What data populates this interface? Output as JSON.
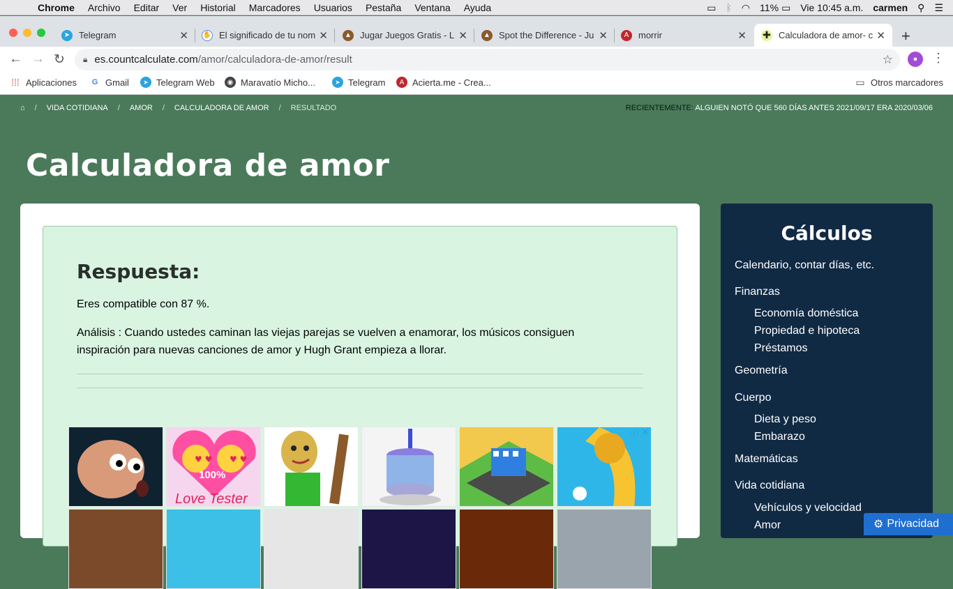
{
  "menubar": {
    "items": [
      "Chrome",
      "Archivo",
      "Editar",
      "Ver",
      "Historial",
      "Marcadores",
      "Usuarios",
      "Pestaña",
      "Ventana",
      "Ayuda"
    ],
    "battery": "11%",
    "clock": "Vie 10:45 a.m.",
    "user": "carmen"
  },
  "tabs": [
    {
      "label": "Telegram",
      "icon": "telegram-icon",
      "color": "#2aa3e0"
    },
    {
      "label": "El significado de tu nom",
      "icon": "hands-icon",
      "color": "#5b8bd6"
    },
    {
      "label": "Jugar Juegos Gratis - L",
      "icon": "figure-icon",
      "color": "#8b5a2b"
    },
    {
      "label": "Spot the Difference - Ju",
      "icon": "figure-icon",
      "color": "#8b5a2b"
    },
    {
      "label": "morrir",
      "icon": "a-icon",
      "color": "#c0262d"
    },
    {
      "label": "Calculadora de amor- c",
      "icon": "plus-icon",
      "color": "#e0c21a"
    }
  ],
  "address": {
    "host": "es.countcalculate.com",
    "path": "/amor/calculadora-de-amor/result"
  },
  "bookmarks": [
    {
      "label": "Aplicaciones",
      "icon": "apps-grid-icon"
    },
    {
      "label": "Gmail",
      "icon": "google-icon"
    },
    {
      "label": "Telegram Web",
      "icon": "telegram-icon"
    },
    {
      "label": "Maravatío Micho...",
      "icon": "globe-icon"
    },
    {
      "label": "Telegram",
      "icon": "telegram-icon"
    },
    {
      "label": "Acierta.me - Crea...",
      "icon": "a-icon"
    },
    {
      "label": "Otros marcadores",
      "icon": "folder-icon"
    }
  ],
  "breadcrumb": [
    "VIDA COTIDIANA",
    "AMOR",
    "CALCULADORA DE AMOR",
    "RESULTADO"
  ],
  "recent": {
    "label": "RECIENTEMENTE:",
    "text": "ALGUIEN NOTÓ QUE 560 DÍAS ANTES 2021/09/17 ERA 2020/03/06"
  },
  "title": "Calculadora de amor",
  "result": {
    "heading": "Respuesta:",
    "compat": "Eres compatible con 87 %.",
    "analysis": "Análisis : Cuando ustedes caminan las viejas parejas se vuelven a enamorar, los músicos consiguen inspiración para nuevas canciones de amor y Hugh Grant empieza a llorar."
  },
  "ads": {
    "love_text": "100%",
    "love_caption": "Love Tester"
  },
  "sidebar": {
    "title": "Cálculos",
    "items": [
      {
        "label": "Calendario, contar días, etc.",
        "level": 0
      },
      {
        "label": "Finanzas",
        "level": 0
      },
      {
        "label": "Economía doméstica",
        "level": 1
      },
      {
        "label": "Propiedad e hipoteca",
        "level": 1
      },
      {
        "label": "Préstamos",
        "level": 1
      },
      {
        "label": "Geometría",
        "level": 0
      },
      {
        "label": "Cuerpo",
        "level": 0
      },
      {
        "label": "Dieta y peso",
        "level": 1
      },
      {
        "label": "Embarazo",
        "level": 1
      },
      {
        "label": "Matemáticas",
        "level": 0
      },
      {
        "label": "Vida cotidiana",
        "level": 0
      },
      {
        "label": "Vehículos y velocidad",
        "level": 1
      },
      {
        "label": "Amor",
        "level": 1
      }
    ]
  },
  "privacy": "Privacidad"
}
